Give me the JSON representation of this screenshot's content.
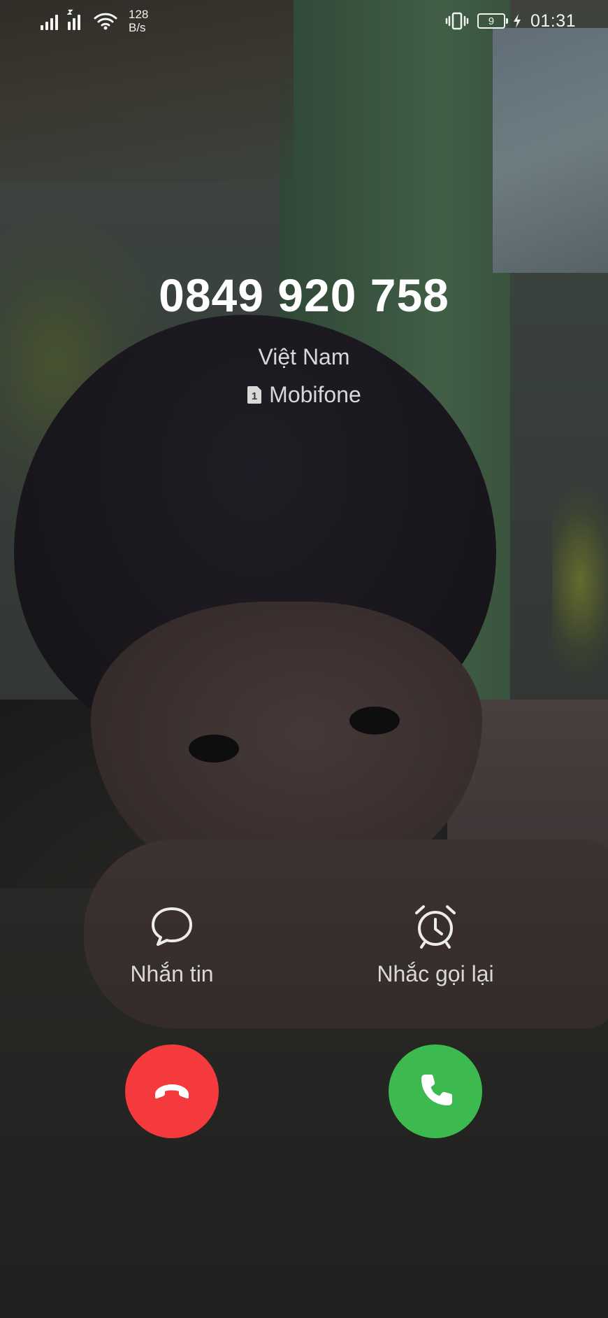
{
  "status_bar": {
    "net_speed_value": "128",
    "net_speed_unit": "B/s",
    "battery_level": "9",
    "time": "01:31",
    "icons": [
      "signal-icon",
      "signal-icon",
      "wifi-icon",
      "vibrate-icon",
      "battery-icon",
      "charging-icon"
    ]
  },
  "caller": {
    "number": "0849 920 758",
    "country": "Việt Nam",
    "sim_slot": "1",
    "carrier": "Mobifone"
  },
  "actions": {
    "message_label": "Nhắn tin",
    "remind_label": "Nhắc gọi lại"
  },
  "buttons": {
    "decline_icon": "hang-up-icon",
    "accept_icon": "phone-icon"
  },
  "colors": {
    "decline": "#f43a3d",
    "accept": "#3cba4f"
  }
}
